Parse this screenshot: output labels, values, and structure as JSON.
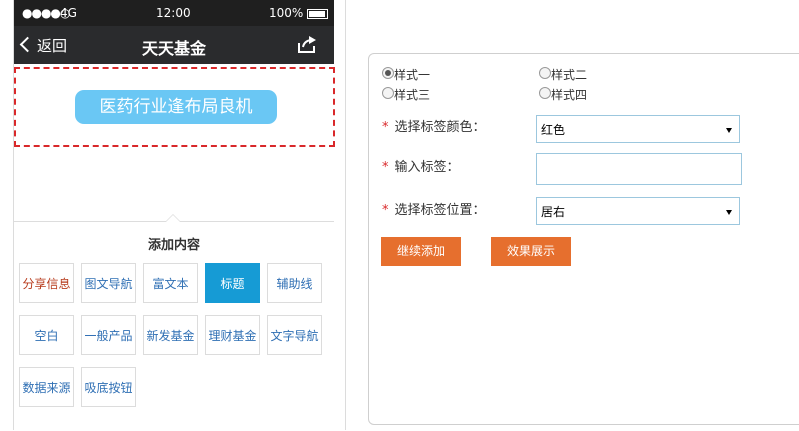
{
  "status_bar": {
    "signal": "●●●●○",
    "network": "4G",
    "time": "12:00",
    "battery": "100%"
  },
  "nav": {
    "back_label": "返回",
    "title": "天天基金"
  },
  "preview": {
    "tag_text": "医药行业逢布局良机"
  },
  "panel": {
    "title": "添加内容",
    "components": [
      {
        "label": "分享信息",
        "state": "red"
      },
      {
        "label": "图文导航",
        "state": ""
      },
      {
        "label": "富文本",
        "state": ""
      },
      {
        "label": "标题",
        "state": "active"
      },
      {
        "label": "辅助线",
        "state": ""
      },
      {
        "label": "空白",
        "state": ""
      },
      {
        "label": "一般产品",
        "state": ""
      },
      {
        "label": "新发基金",
        "state": ""
      },
      {
        "label": "理财基金",
        "state": ""
      },
      {
        "label": "文字导航",
        "state": ""
      },
      {
        "label": "数据来源",
        "state": ""
      },
      {
        "label": "吸底按钮",
        "state": ""
      }
    ]
  },
  "form": {
    "styles": [
      {
        "label": "样式一",
        "checked": true
      },
      {
        "label": "样式二",
        "checked": false
      },
      {
        "label": "样式三",
        "checked": false
      },
      {
        "label": "样式四",
        "checked": false
      }
    ],
    "required_mark": "*",
    "color_label": "选择标签颜色：",
    "color_value": "红色",
    "text_label": "输入标签：",
    "text_value": "",
    "position_label": "选择标签位置：",
    "position_value": "居右",
    "continue_button": "继续添加",
    "preview_button": "效果展示"
  },
  "colors": {
    "accent_orange": "#e66f2e",
    "tag_blue": "#6ac7f4",
    "active_blue": "#169bd5",
    "selection_red": "#d9282a"
  }
}
